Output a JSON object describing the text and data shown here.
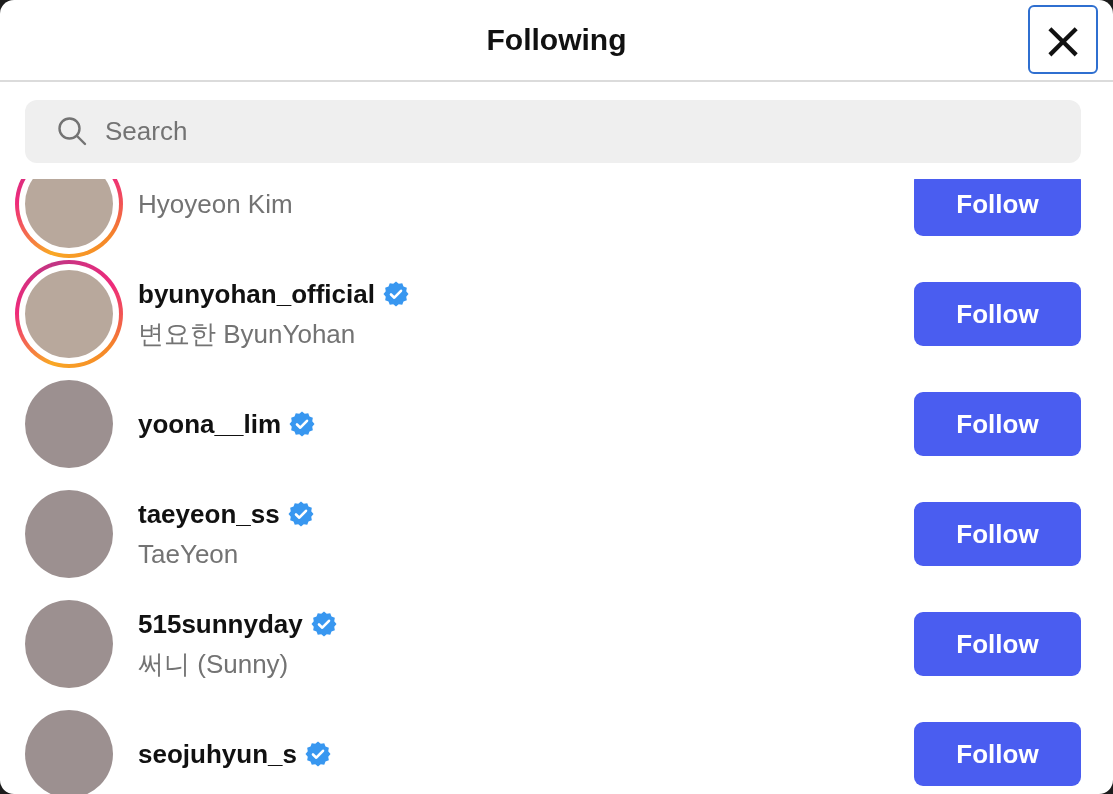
{
  "dialog": {
    "title": "Following",
    "close_label": "×"
  },
  "search": {
    "placeholder": "Search"
  },
  "users": [
    {
      "name": "Hyoyeon Kim",
      "story": true,
      "button": "Follow"
    },
    {
      "username": "byunyohan_official",
      "name": "변요한 ByunYohan",
      "story": true,
      "verified": true,
      "button": "Follow"
    },
    {
      "username": "yoona__lim",
      "story": false,
      "verified": true,
      "button": "Follow"
    },
    {
      "username": "taeyeon_ss",
      "name": "TaeYeon",
      "story": false,
      "verified": true,
      "button": "Follow"
    },
    {
      "username": "515sunnyday",
      "name": "써니 (Sunny)",
      "story": false,
      "verified": true,
      "button": "Follow"
    },
    {
      "username": "seojuhyun_s",
      "story": false,
      "verified": true,
      "button": "Follow"
    }
  ]
}
